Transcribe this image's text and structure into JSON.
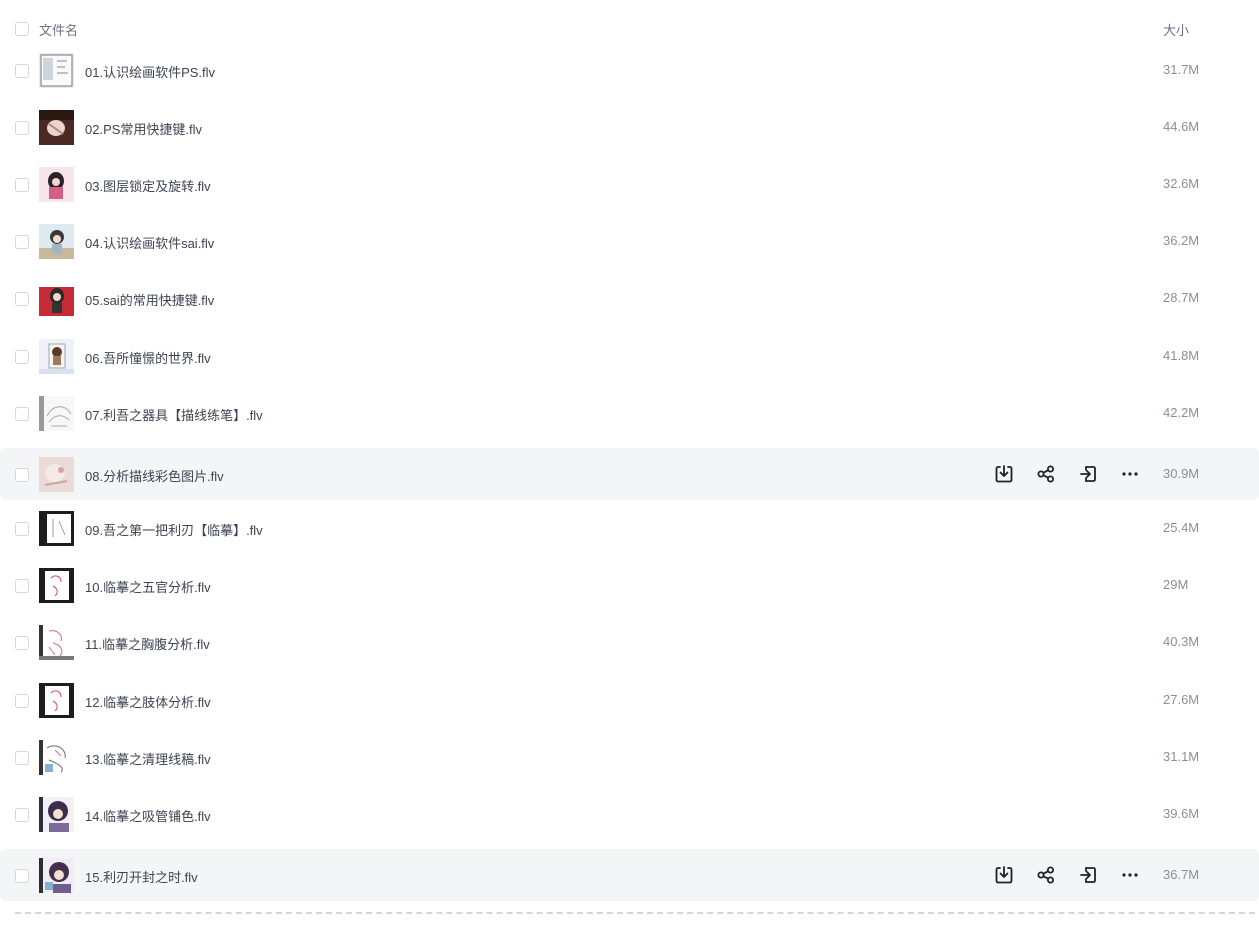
{
  "header": {
    "name_label": "文件名",
    "size_label": "大小"
  },
  "rows": [
    {
      "name": "01.认识绘画软件PS.flv",
      "size": "31.7M",
      "thumb": "ps",
      "hover": false
    },
    {
      "name": "02.PS常用快捷键.flv",
      "size": "44.6M",
      "thumb": "dark-brown",
      "hover": false
    },
    {
      "name": "03.图层锁定及旋转.flv",
      "size": "32.6M",
      "thumb": "pink-char",
      "hover": false
    },
    {
      "name": "04.认识绘画软件sai.flv",
      "size": "36.2M",
      "thumb": "light-char",
      "hover": false
    },
    {
      "name": "05.sai的常用快捷键.flv",
      "size": "28.7M",
      "thumb": "red-char",
      "hover": false
    },
    {
      "name": "06.吾所憧憬的世界.flv",
      "size": "41.8M",
      "thumb": "framed-char",
      "hover": false
    },
    {
      "name": "07.利吾之器具【描线练笔】.flv",
      "size": "42.2M",
      "thumb": "sketch-lines",
      "hover": false
    },
    {
      "name": "08.分析描线彩色图片.flv",
      "size": "30.9M",
      "thumb": "soft-pink",
      "hover": true
    },
    {
      "name": "09.吾之第一把利刃【临摹】.flv",
      "size": "25.4M",
      "thumb": "dark-frame",
      "hover": false
    },
    {
      "name": "10.临摹之五官分析.flv",
      "size": "29M",
      "thumb": "dark-frame-red",
      "hover": false
    },
    {
      "name": "11.临摹之胸腹分析.flv",
      "size": "40.3M",
      "thumb": "sketch-red",
      "hover": false
    },
    {
      "name": "12.临摹之肢体分析.flv",
      "size": "27.6M",
      "thumb": "dark-frame-red",
      "hover": false
    },
    {
      "name": "13.临摹之清理线稿.flv",
      "size": "31.1M",
      "thumb": "sketch-blue",
      "hover": false
    },
    {
      "name": "14.临摹之吸管铺色.flv",
      "size": "39.6M",
      "thumb": "purple-char",
      "hover": false
    },
    {
      "name": "15.利刃开封之时.flv",
      "size": "36.7M",
      "thumb": "purple-char-2",
      "hover": true
    }
  ],
  "row_actions": {
    "download": "download-icon",
    "share": "share-icon",
    "move": "move-to-icon",
    "more": "more-icon"
  }
}
